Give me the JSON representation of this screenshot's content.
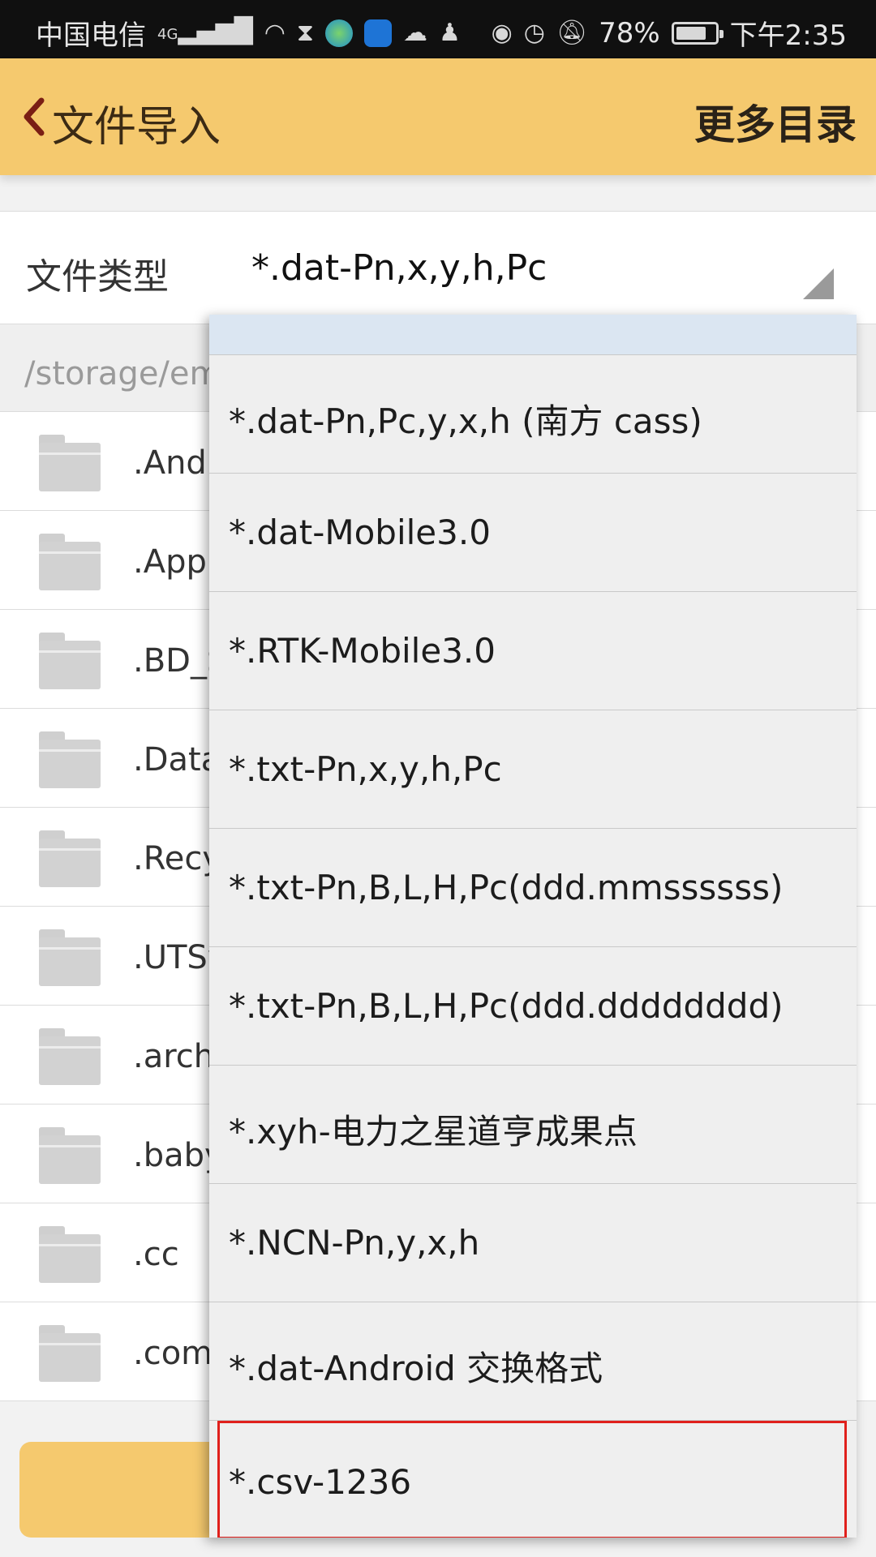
{
  "status_bar": {
    "carrier": "中国电信",
    "network": "4G",
    "battery_percent": "78%",
    "battery_level": 0.78,
    "time": "下午2:35"
  },
  "header": {
    "title": "文件导入",
    "more_label": "更多目录"
  },
  "file_type": {
    "label": "文件类型",
    "value": "*.dat-Pn,x,y,h,Pc"
  },
  "path": {
    "text": "/storage/em"
  },
  "files": [
    {
      "name": ".Andr"
    },
    {
      "name": ".Appl"
    },
    {
      "name": ".BD_S"
    },
    {
      "name": ".Data"
    },
    {
      "name": ".Recy"
    },
    {
      "name": ".UTSy"
    },
    {
      "name": ".arch"
    },
    {
      "name": ".baby"
    },
    {
      "name": ".cc"
    },
    {
      "name": ".com"
    }
  ],
  "dropdown": {
    "options": [
      {
        "label": "*.dat-Pn,Pc,y,x,h (南方 cass)"
      },
      {
        "label": "*.dat-Mobile3.0"
      },
      {
        "label": "*.RTK-Mobile3.0"
      },
      {
        "label": "*.txt-Pn,x,y,h,Pc"
      },
      {
        "label": "*.txt-Pn,B,L,H,Pc(ddd.mmssssss)"
      },
      {
        "label": "*.txt-Pn,B,L,H,Pc(ddd.dddddddd)"
      },
      {
        "label": "*.xyh-电力之星道亨成果点"
      },
      {
        "label": "*.NCN-Pn,y,x,h"
      },
      {
        "label": "*.dat-Android 交换格式"
      },
      {
        "label": "*.csv-1236"
      }
    ]
  },
  "colors": {
    "accent": "#f5c96e",
    "highlight_border": "#e0201c",
    "selected_option_bg": "#dbe6f2"
  }
}
